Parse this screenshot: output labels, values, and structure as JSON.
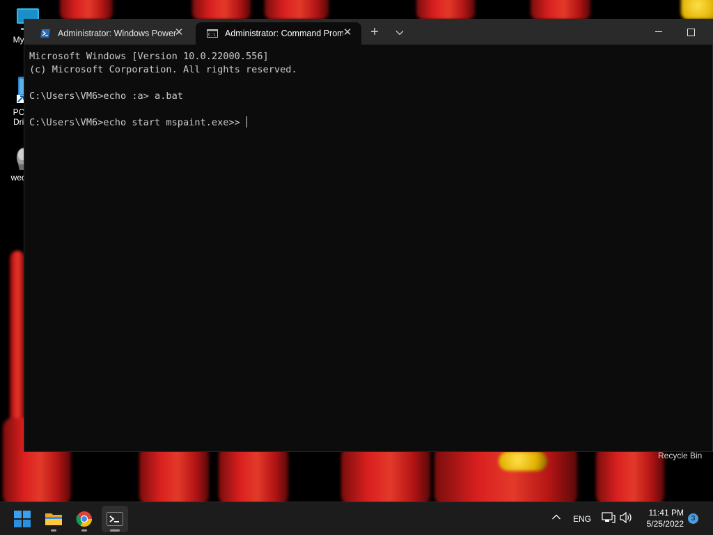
{
  "desktop": {
    "icons": [
      {
        "label": "My Co",
        "icon": "monitor-icon"
      },
      {
        "label": "PC H",
        "label2": "Drive",
        "icon": "pc-health-icon"
      },
      {
        "label": "wedn",
        "icon": "image-file-icon"
      }
    ],
    "recycle_bin_label": "Recycle Bin"
  },
  "terminal": {
    "tabs": [
      {
        "title": "Administrator: Windows PowerShell",
        "icon": "powershell-icon",
        "active": false
      },
      {
        "title": "Administrator: Command Prompt",
        "icon": "cmd-icon",
        "active": true
      }
    ],
    "new_tab_symbol": "+",
    "dropdown_symbol": "⌄",
    "lines": [
      "Microsoft Windows [Version 10.0.22000.556]",
      "(c) Microsoft Corporation. All rights reserved.",
      "",
      "C:\\Users\\VM6>echo :a> a.bat",
      "",
      "C:\\Users\\VM6>echo start mspaint.exe>> "
    ]
  },
  "taskbar": {
    "apps": [
      "start-icon",
      "file-explorer-icon",
      "chrome-icon",
      "terminal-icon"
    ],
    "language": "ENG",
    "time": "11:41 PM",
    "date": "5/25/2022",
    "notification_count": "3"
  },
  "colors": {
    "console_bg": "#0c0c0c",
    "console_fg": "#cccccc",
    "titlebar": "#2a2a2a",
    "taskbar": "#1c1c1c",
    "accent": "#4a9dde"
  }
}
